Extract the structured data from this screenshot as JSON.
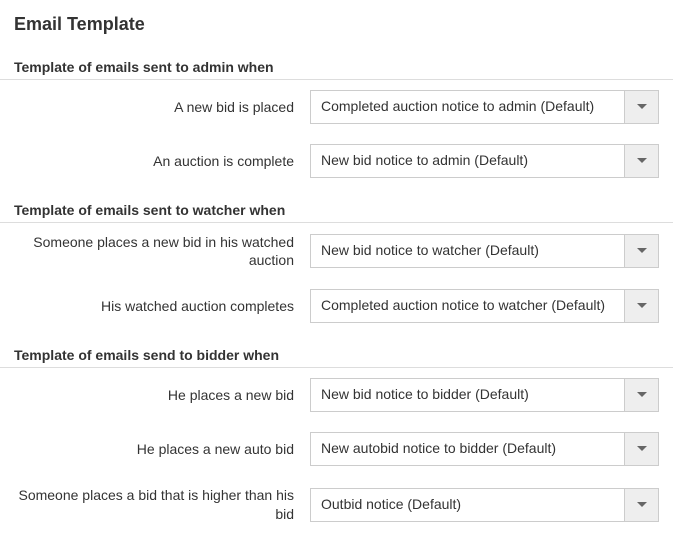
{
  "page": {
    "title": "Email Template"
  },
  "sections": {
    "admin": {
      "header": "Template of emails sent to admin when",
      "fields": {
        "new_bid": {
          "label": "A new bid is placed",
          "value": "Completed auction notice to admin (Default)"
        },
        "complete": {
          "label": "An auction is complete",
          "value": "New bid notice to admin (Default)"
        }
      }
    },
    "watcher": {
      "header": "Template of emails sent to watcher when",
      "fields": {
        "new_bid": {
          "label": "Someone places a new bid in his watched auction",
          "value": "New bid notice to watcher (Default)"
        },
        "complete": {
          "label": "His watched auction completes",
          "value": "Completed auction notice to watcher (Default)"
        }
      }
    },
    "bidder": {
      "header": "Template of emails send to bidder when",
      "fields": {
        "new_bid": {
          "label": "He places a new bid",
          "value": "New bid notice to bidder (Default)"
        },
        "auto_bid": {
          "label": "He places a new auto bid",
          "value": "New autobid notice to bidder (Default)"
        },
        "outbid": {
          "label": "Someone places a bid that is higher than his bid",
          "value": "Outbid notice (Default)"
        }
      }
    }
  }
}
